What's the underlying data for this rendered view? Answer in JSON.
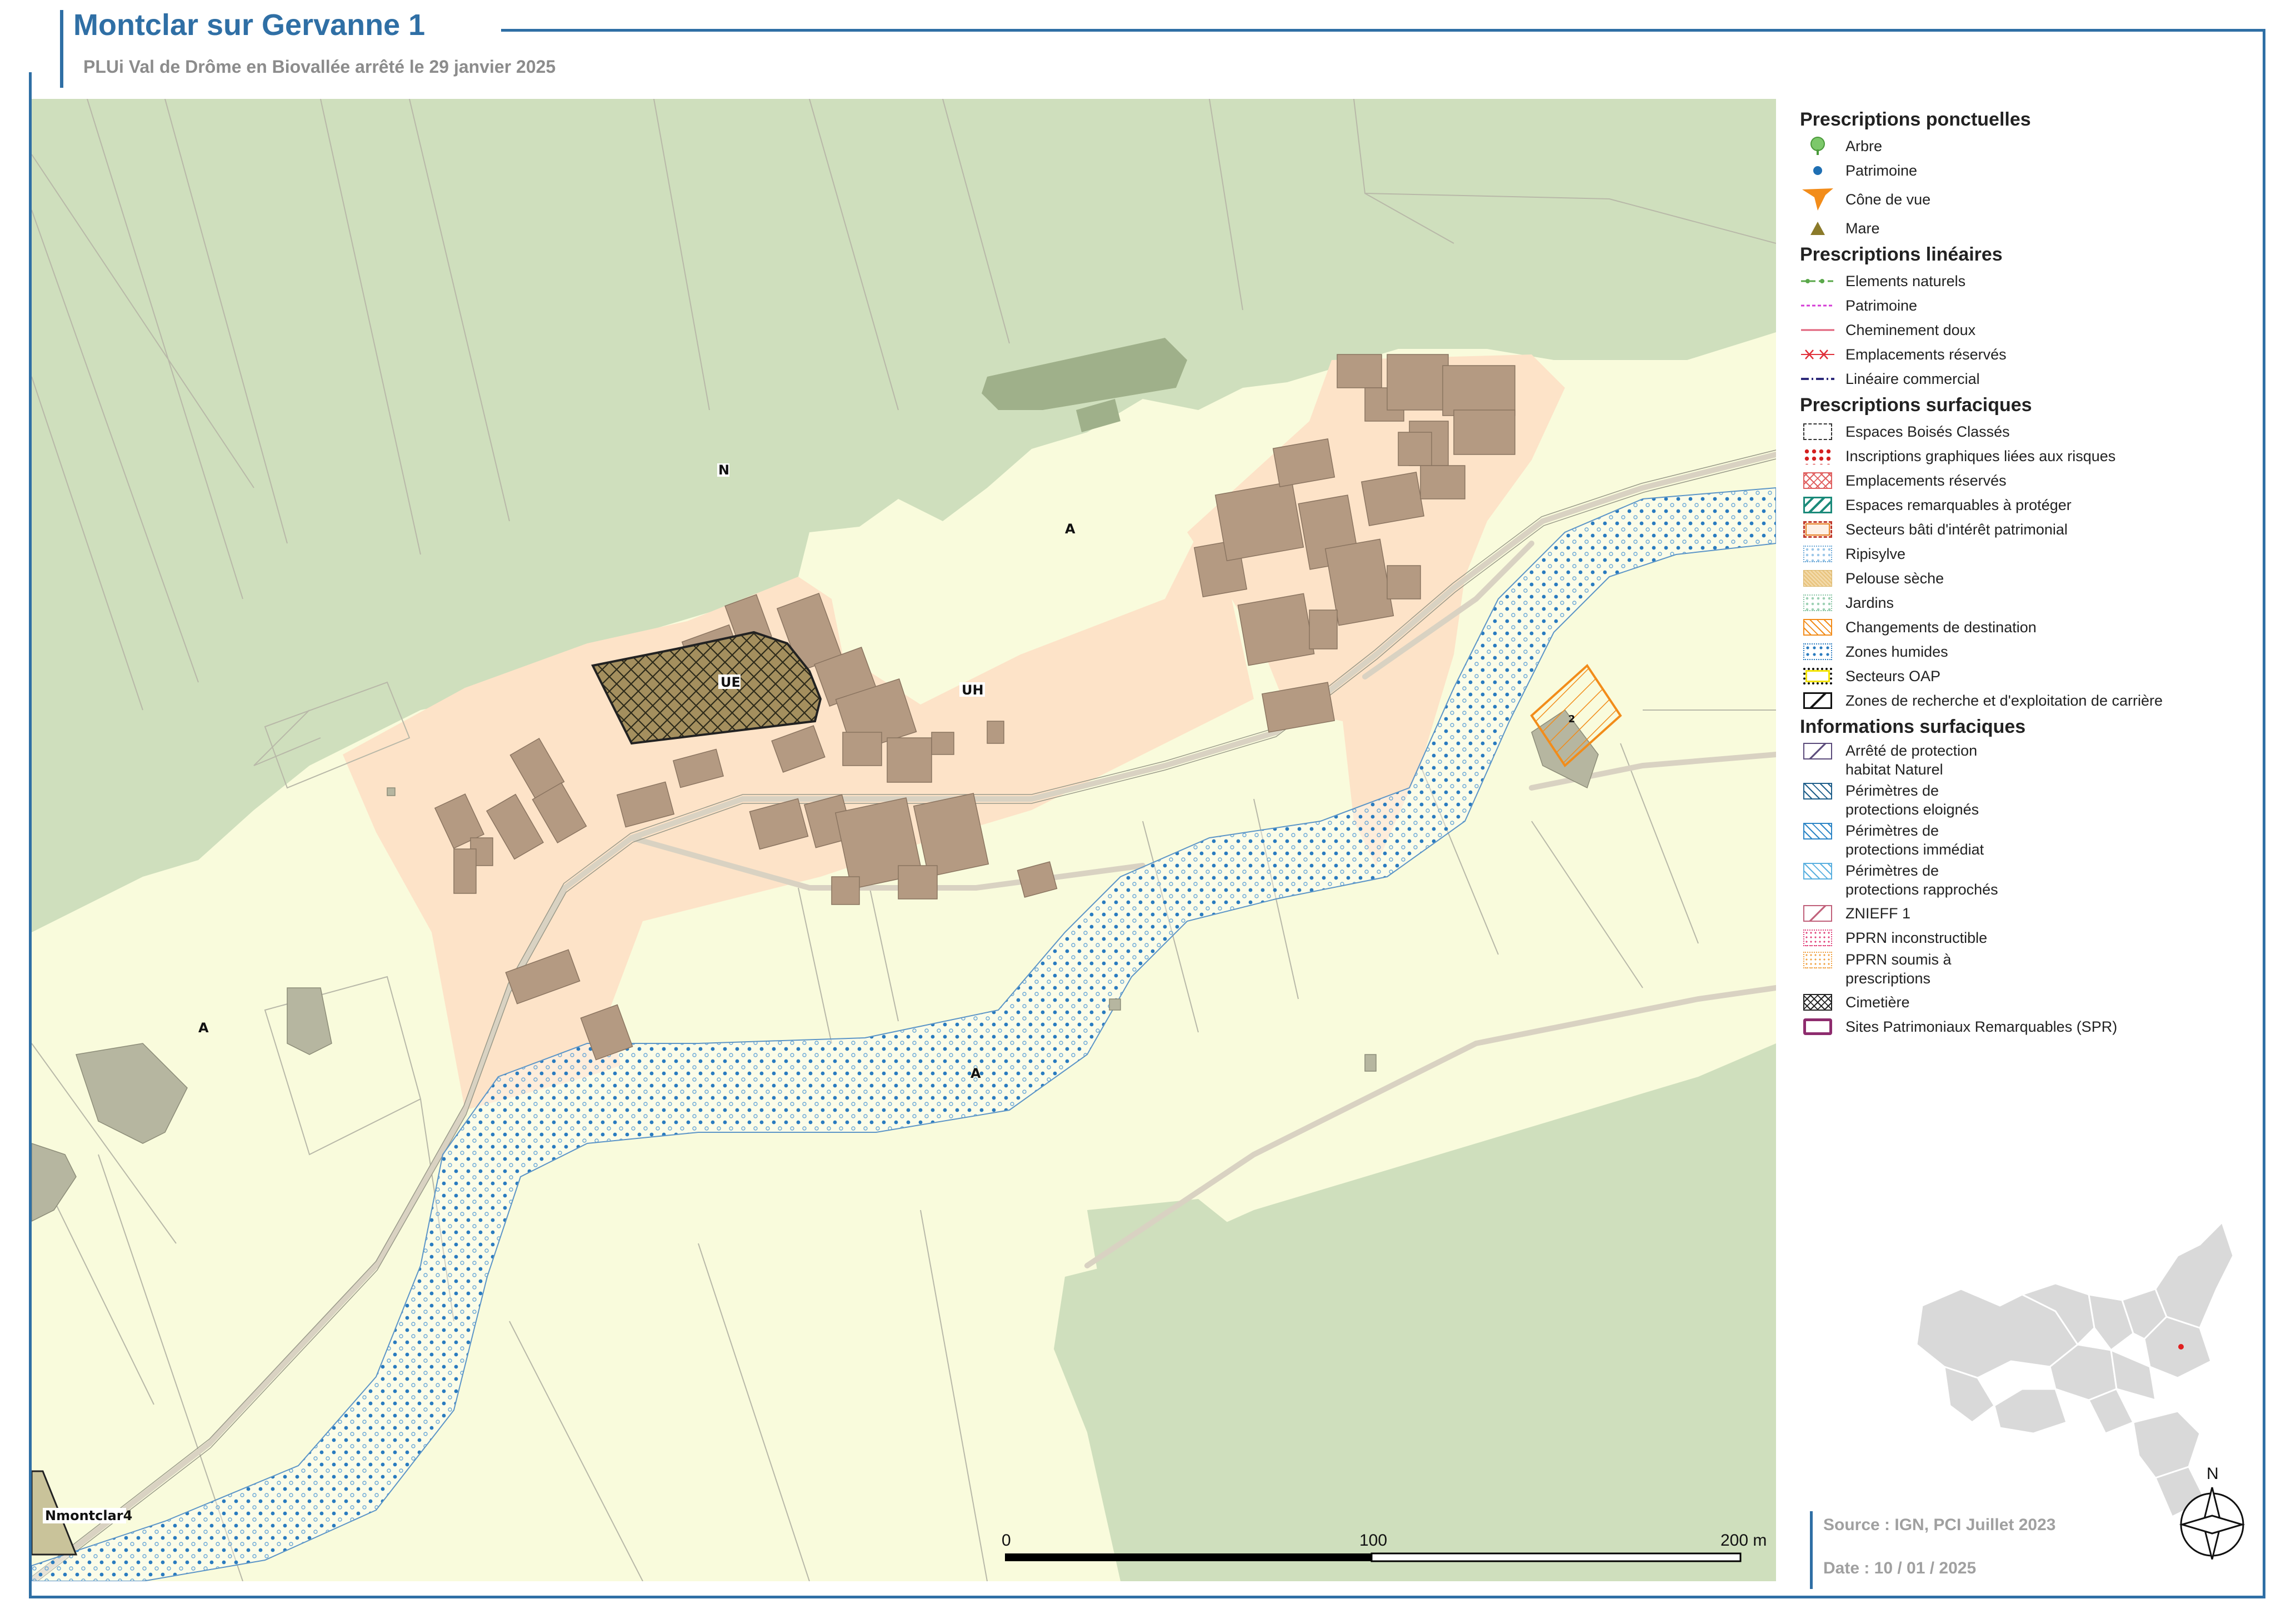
{
  "header": {
    "title": "Montclar sur Gervanne 1",
    "subtitle": "PLUi Val de Drôme en Biovallée arrêté le 29 janvier 2025"
  },
  "map": {
    "zone_labels": {
      "n": "N",
      "a_top": "A",
      "a_left": "A",
      "a_river": "A",
      "ue": "UE",
      "uh": "UH",
      "nmontclar4": "Nmontclar4",
      "oap_number": "2"
    },
    "scale": {
      "tick_0": "0",
      "tick_100": "100",
      "tick_200": "200 m"
    },
    "colors": {
      "forest": "#cfdfbd",
      "agricultural": "#f9fbdc",
      "urban_zone": "#fde3c8",
      "building": "#b49a82",
      "river_hatch": "#2a7bbf",
      "frame_blue": "#2f6fa5"
    }
  },
  "legend": {
    "ponctuelles": {
      "heading": "Prescriptions ponctuelles",
      "items": [
        {
          "label": "Arbre",
          "icon": "tree-icon",
          "color": "#7cc86a"
        },
        {
          "label": "Patrimoine",
          "icon": "dot-icon",
          "color": "#1f6fb3"
        },
        {
          "label": "Cône de vue",
          "icon": "view-cone-icon",
          "color": "#f28c1a"
        },
        {
          "label": "Mare",
          "icon": "triangle-icon",
          "color": "#8b7a2a"
        }
      ]
    },
    "lineaires": {
      "heading": "Prescriptions linéaires",
      "items": [
        {
          "label": "Elements naturels",
          "color": "#5aa84a"
        },
        {
          "label": "Patrimoine",
          "color": "#d43bd6"
        },
        {
          "label": "Cheminement doux",
          "color": "#e0607a"
        },
        {
          "label": "Emplacements réservés",
          "color": "#e0303a"
        },
        {
          "label": "Linéaire commercial",
          "color": "#2d2a7a"
        }
      ]
    },
    "surfaciques": {
      "heading": "Prescriptions surfaciques",
      "items": [
        {
          "label": "Espaces Boisés Classés"
        },
        {
          "label": "Inscriptions graphiques liées aux risques"
        },
        {
          "label": "Emplacements réservés"
        },
        {
          "label": "Espaces remarquables à protéger"
        },
        {
          "label": "Secteurs bâti d'intérêt patrimonial"
        },
        {
          "label": "Ripisylve"
        },
        {
          "label": "Pelouse sèche"
        },
        {
          "label": "Jardins"
        },
        {
          "label": "Changements de destination"
        },
        {
          "label": "Zones humides"
        },
        {
          "label": "Secteurs OAP"
        },
        {
          "label": "Zones de recherche et d'exploitation de carrière"
        }
      ]
    },
    "informations": {
      "heading": "Informations surfaciques",
      "items": [
        {
          "line1": "Arrêté de protection",
          "line2": "habitat Naturel"
        },
        {
          "line1": "Périmètres de",
          "line2": "protections eloignés"
        },
        {
          "line1": "Périmètres de",
          "line2": "protections immédiat"
        },
        {
          "line1": "Périmètres de",
          "line2": "protections rapprochés"
        },
        {
          "line1": "ZNIEFF 1",
          "line2": ""
        },
        {
          "line1": "PPRN inconstructible",
          "line2": ""
        },
        {
          "line1": "PPRN soumis à",
          "line2": "prescriptions"
        },
        {
          "line1": "Cimetière",
          "line2": ""
        },
        {
          "line1": "Sites Patrimoniaux Remarquables (SPR)",
          "line2": ""
        }
      ]
    }
  },
  "footer": {
    "source": "Source : IGN, PCI Juillet 2023",
    "date": "Date : 10 / 01 / 2025",
    "north": "N"
  }
}
